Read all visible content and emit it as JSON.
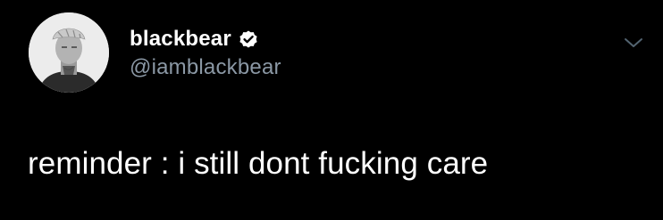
{
  "tweet": {
    "author": {
      "display_name": "blackbear",
      "handle": "@iamblackbear",
      "verified": true
    },
    "text": "reminder : i still dont fucking care"
  },
  "icons": {
    "verified": "verified-badge-icon",
    "menu": "chevron-down-icon"
  },
  "colors": {
    "background": "#000000",
    "text": "#ffffff",
    "handle": "#8b98a5",
    "chevron": "#536471"
  }
}
